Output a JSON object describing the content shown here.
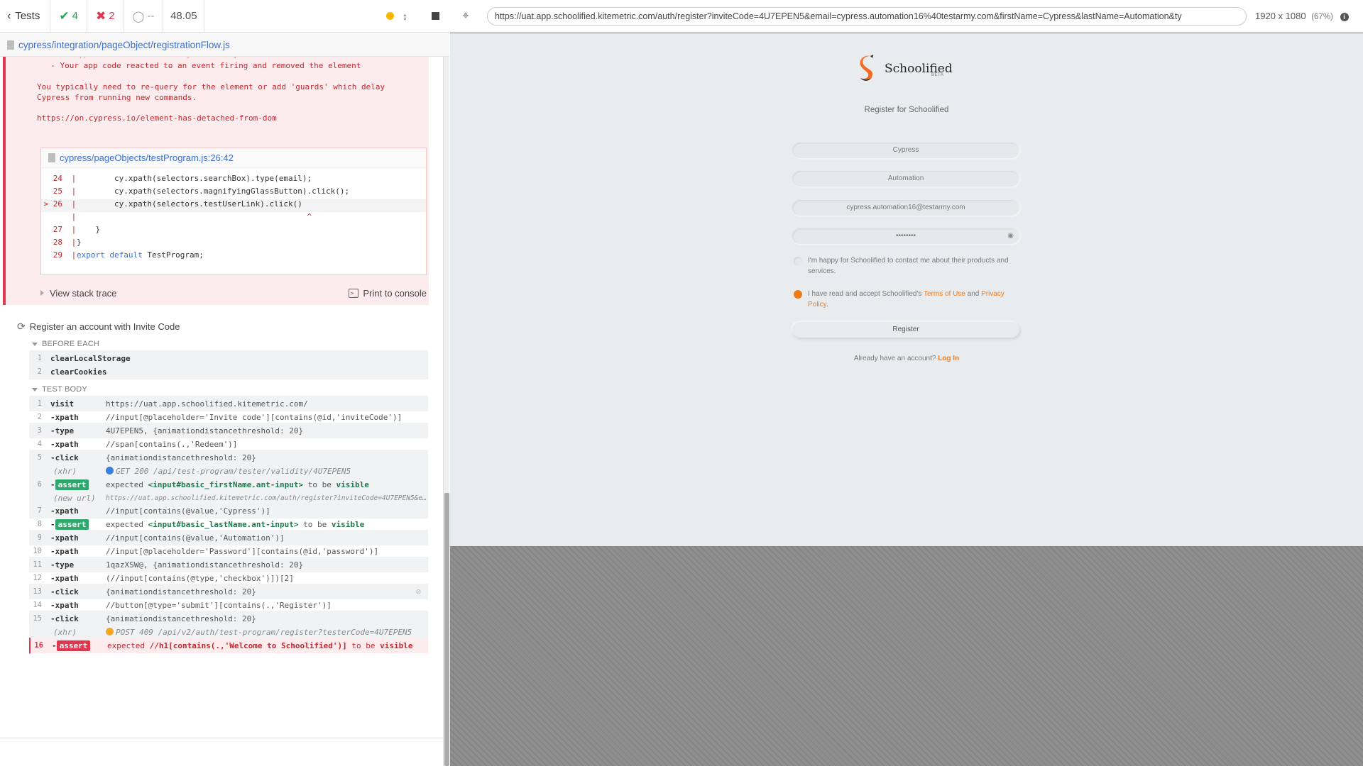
{
  "topbar": {
    "tests_label": "Tests",
    "passed": "4",
    "failed": "2",
    "pending": "--",
    "duration": "48.05"
  },
  "spec": {
    "path": "cypress/integration/pageObject/registrationFlow.js"
  },
  "error": {
    "lines": [
      "  - Your app code reacted to an event firing and removed the element",
      "You typically need to re-query for the element or add 'guards' which delay",
      "Cypress from running new commands.",
      "https://on.cypress.io/element-has-detached-from-dom"
    ],
    "codeframe_file": "cypress/pageObjects/testProgram.js:26:42",
    "code": [
      {
        "num": "24",
        "code": "        cy.xpath(selectors.searchBox).type(email);"
      },
      {
        "num": "25",
        "code": "        cy.xpath(selectors.magnifyingGlassButton).click();"
      },
      {
        "num": "26",
        "code": "        cy.xpath(selectors.testUserLink).click()",
        "marker": ">"
      },
      {
        "num": "",
        "code": "                                                 ^"
      },
      {
        "num": "27",
        "code": "    }"
      },
      {
        "num": "28",
        "code": "}"
      },
      {
        "num": "29",
        "code": "export default TestProgram;"
      }
    ],
    "view_stack_trace": "View stack trace",
    "print_to_console": "Print to console"
  },
  "test": {
    "title": "Register an account with Invite Code",
    "before_each_label": "BEFORE EACH",
    "before_each": [
      {
        "n": "1",
        "name": "clearLocalStorage"
      },
      {
        "n": "2",
        "name": "clearCookies"
      }
    ],
    "test_body_label": "TEST BODY",
    "commands": [
      {
        "n": "1",
        "name": "visit",
        "msg": "https://uat.app.schoolified.kitemetric.com/"
      },
      {
        "n": "2",
        "name": "-xpath",
        "msg": "//input[@placeholder='Invite code'][contains(@id,'inviteCode')]"
      },
      {
        "n": "3",
        "name": "-type",
        "msg": "4U7EPEN5, {animationdistancethreshold: 20}"
      },
      {
        "n": "4",
        "name": "-xpath",
        "msg": "//span[contains(.,'Redeem')]"
      },
      {
        "n": "5",
        "name": "-click",
        "msg": "{animationdistancethreshold: 20}"
      },
      {
        "n": "",
        "name": "(xhr)",
        "msg": "GET 200 /api/test-program/tester/validity/4U7EPEN5",
        "sys": true,
        "dot": "blue"
      },
      {
        "n": "6",
        "name": "-assert",
        "msg_pre": "expected ",
        "msg_b1": "<input#basic_firstName.ant-input>",
        "msg_mid": " to be ",
        "msg_b2": "visible",
        "assert": true
      },
      {
        "n": "",
        "name": "(new url)",
        "msg": "https://uat.app.schoolified.kitemetric.com/auth/register?inviteCode=4U7EPEN5&e…",
        "sys": true
      },
      {
        "n": "7",
        "name": "-xpath",
        "msg": "//input[contains(@value,'Cypress')]"
      },
      {
        "n": "8",
        "name": "-assert",
        "msg_pre": "expected ",
        "msg_b1": "<input#basic_lastName.ant-input>",
        "msg_mid": " to be ",
        "msg_b2": "visible",
        "assert": true
      },
      {
        "n": "9",
        "name": "-xpath",
        "msg": "//input[contains(@value,'Automation')]"
      },
      {
        "n": "10",
        "name": "-xpath",
        "msg": "//input[@placeholder='Password'][contains(@id,'password')]"
      },
      {
        "n": "11",
        "name": "-type",
        "msg": "1qazXSW@, {animationdistancethreshold: 20}"
      },
      {
        "n": "12",
        "name": "-xpath",
        "msg": "(//input[contains(@type,'checkbox')])[2]"
      },
      {
        "n": "13",
        "name": "-click",
        "msg": "{animationdistancethreshold: 20}",
        "hidden_icon": true
      },
      {
        "n": "14",
        "name": "-xpath",
        "msg": "//button[@type='submit'][contains(.,'Register')]"
      },
      {
        "n": "15",
        "name": "-click",
        "msg": "{animationdistancethreshold: 20}"
      },
      {
        "n": "",
        "name": "(xhr)",
        "msg": "POST 409 /api/v2/auth/test-program/register?testerCode=4U7EPEN5",
        "sys": true,
        "dot": "orange"
      },
      {
        "n": "16",
        "name": "-assert",
        "msg_pre": "expected ",
        "msg_b1": "//h1[contains(.,'Welcome to Schoolified')]",
        "msg_mid": " to be ",
        "msg_b2": "visible",
        "assert": true,
        "failed": true
      }
    ]
  },
  "aut": {
    "url": "https://uat.app.schoolified.kitemetric.com/auth/register?inviteCode=4U7EPEN5&email=cypress.automation16%40testarmy.com&firstName=Cypress&lastName=Automation&ty",
    "viewport": "1920 x 1080",
    "zoom": "(67%)"
  },
  "app": {
    "brand": "Schoolified",
    "beta": "BETA",
    "title": "Register for Schoolified",
    "first_name": "Cypress",
    "last_name": "Automation",
    "email": "cypress.automation16@testarmy.com",
    "password_mask": "••••••••",
    "contact_consent": "I'm happy for Schoolified to contact me about their products and services.",
    "terms_pre": "I have read and accept Schoolified's ",
    "terms_link": "Terms of Use",
    "terms_and": " and ",
    "privacy_link": "Privacy Policy",
    "terms_end": ".",
    "register_button": "Register",
    "already_text": "Already have an account? ",
    "login_link": "Log In"
  },
  "colors": {
    "pass": "#26a65b",
    "fail": "#e0374f",
    "brand_orange": "#f07a1a",
    "link_blue": "#3a6fd8"
  }
}
